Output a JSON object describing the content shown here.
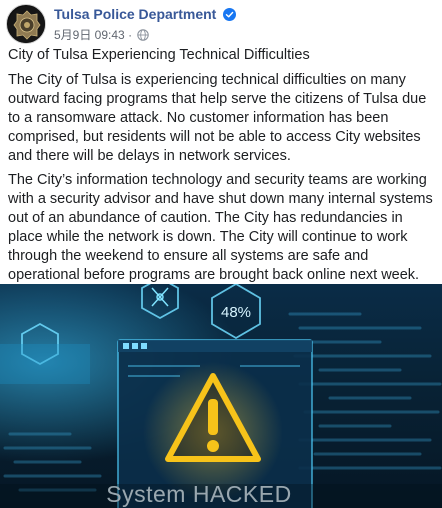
{
  "post": {
    "page_name": "Tulsa Police Department",
    "timestamp": "5月9日 09:43",
    "separator": "·",
    "title": "City of Tulsa Experiencing Technical Difficulties",
    "paragraph1": "The City of Tulsa is experiencing technical difficulties on many outward facing programs that help serve the citizens of Tulsa due to a ransomware attack. No customer information has been comprised, but residents will not be able to access City websites and there will be delays in network services.",
    "paragraph2": "The City’s information technology and security teams are working with a security advisor and have shut down many internal systems out of an abundance of caution. The City has redundancies in place while the network is down. The City will continue to work through the weekend to ensure all systems are safe and operational before programs are brought back online next week."
  },
  "image": {
    "percent_label": "48%",
    "warning_text": "System HACKED"
  },
  "colors": {
    "page_name": "#385898",
    "verified": "#1877f2",
    "warning": "#f7c31a",
    "glow": "#5fd2ff"
  },
  "icons": [
    "police-badge-avatar",
    "verified-badge-icon",
    "globe-icon",
    "warning-triangle-icon",
    "hexagon-icon"
  ]
}
